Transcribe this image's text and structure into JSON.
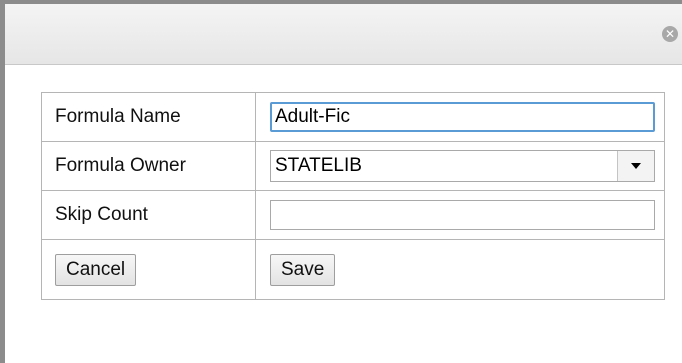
{
  "dialog": {
    "close_icon": "close-circle-icon",
    "close_glyph": "✕"
  },
  "form": {
    "formula_name": {
      "label": "Formula Name",
      "value": "Adult-Fic"
    },
    "formula_owner": {
      "label": "Formula Owner",
      "selected": "STATELIB"
    },
    "skip_count": {
      "label": "Skip Count",
      "value": ""
    },
    "buttons": {
      "cancel": "Cancel",
      "save": "Save"
    }
  },
  "colors": {
    "focus_border": "#5b9bd5",
    "table_border": "#b5b5b5",
    "window_frame": "#8c8c8c"
  }
}
